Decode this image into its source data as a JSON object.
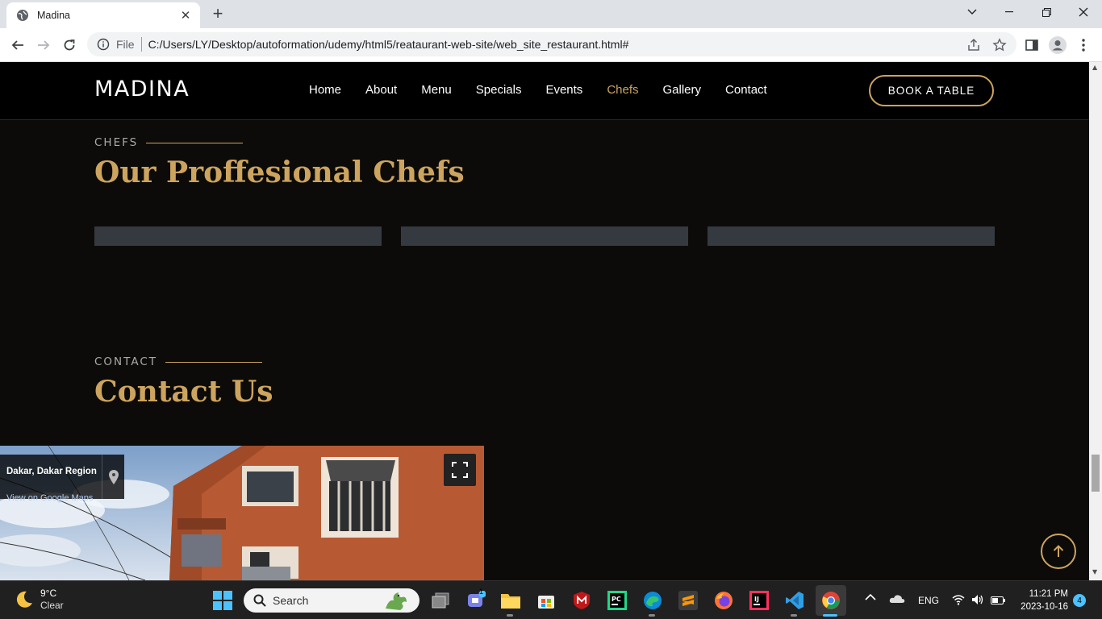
{
  "browser": {
    "tab_title": "Madina",
    "new_tab": "+",
    "scheme": "File",
    "url": "C:/Users/LY/Desktop/autoformation/udemy/html5/reataurant-web-site/web_site_restaurant.html#"
  },
  "site": {
    "logo": "MADINA",
    "nav": [
      "Home",
      "About",
      "Menu",
      "Specials",
      "Events",
      "Chefs",
      "Gallery",
      "Contact"
    ],
    "active_nav": "Chefs",
    "cta": "BOOK A TABLE",
    "accent": "#cda45e",
    "chefs_section": {
      "label": "CHEFS",
      "title": "Our Proffesional Chefs"
    },
    "contact_section": {
      "label": "CONTACT",
      "title": "Contact Us"
    },
    "map": {
      "place": "Dakar, Dakar Region",
      "link": "View on Google Maps"
    }
  },
  "taskbar": {
    "weather_temp": "9°C",
    "weather_cond": "Clear",
    "search": "Search",
    "language": "ENG",
    "time": "11:21 PM",
    "date": "2023-10-16",
    "notification_count": "4",
    "teams_badge": "1"
  }
}
